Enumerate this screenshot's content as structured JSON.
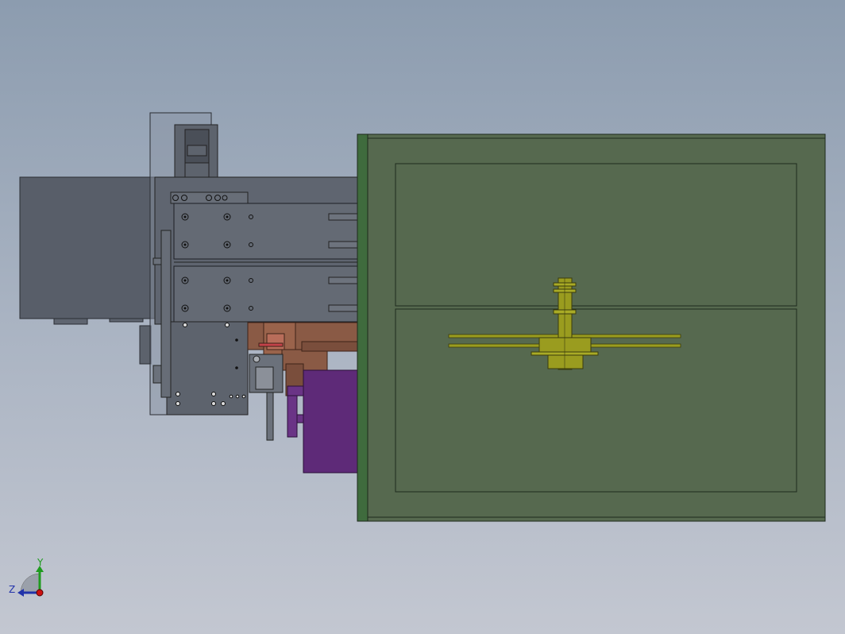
{
  "view": {
    "background_top": "#8c9caf",
    "background_bottom": "#c3c7d1"
  },
  "triad": {
    "y_label": "Y",
    "z_label": "Z",
    "y_color": "#1f9b1f",
    "z_color": "#2233aa",
    "x_color": "#cc1111"
  },
  "colors": {
    "steel_dark": "#585e69",
    "steel_mid": "#6b717b",
    "enclosure_green": "#56694f",
    "enclosure_edge": "#3f6b3d",
    "copper": "#8a5a45",
    "purple": "#5e2a78",
    "olive": "#9a9c1f"
  }
}
